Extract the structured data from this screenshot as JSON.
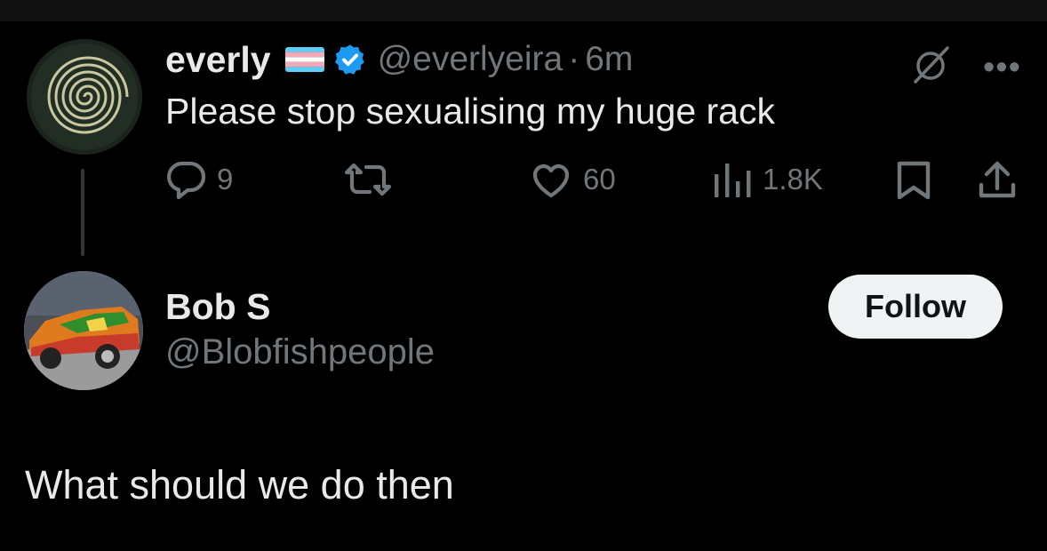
{
  "tweet": {
    "author_name": "everly",
    "author_handle": "@everlyeira",
    "separator": "·",
    "time": "6m",
    "text": "Please stop sexualising my huge rack",
    "stats": {
      "replies": "9",
      "retweets": "",
      "likes": "60",
      "views": "1.8K"
    },
    "icons": [
      "trans-flag-icon",
      "verified-badge-icon",
      "grok-icon",
      "more-icon",
      "reply-icon",
      "retweet-icon",
      "like-icon",
      "views-icon",
      "bookmark-icon",
      "share-icon"
    ]
  },
  "reply_user": {
    "name": "Bob S",
    "handle": "@Blobfishpeople",
    "follow_label": "Follow",
    "text": "What should we do then"
  },
  "colors": {
    "background": "#000000",
    "text_primary": "#e7e9ea",
    "text_secondary": "#71767b",
    "verified_blue": "#1d9bf0",
    "follow_bg": "#eff3f4",
    "trans_blue": "#5bcefa",
    "trans_pink": "#f5a9b8"
  }
}
